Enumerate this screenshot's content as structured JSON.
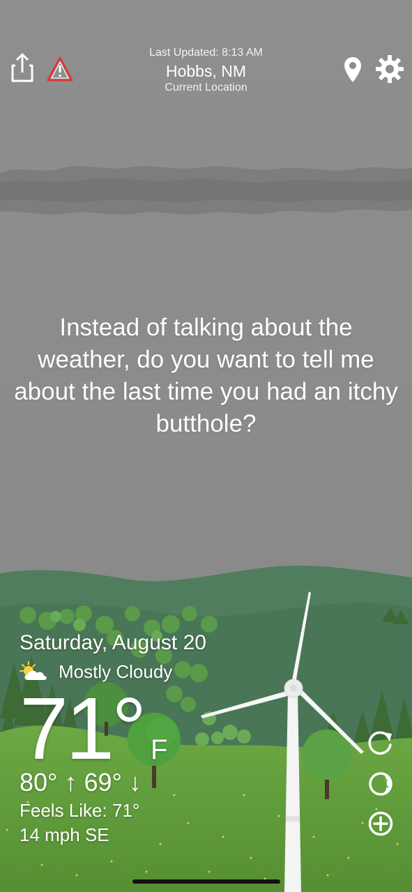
{
  "header": {
    "last_updated": "Last Updated: 8:13 AM",
    "city": "Hobbs, NM",
    "location_label": "Current Location"
  },
  "toolbar": {
    "share_icon": "share-icon",
    "alert_icon": "warning-icon",
    "location_icon": "map-pin-icon",
    "settings_icon": "gear-icon"
  },
  "message": "Instead of talking about the weather, do you want to tell me about the last time you had an itchy butthole?",
  "weather": {
    "date": "Saturday, August 20",
    "condition": "Mostly Cloudy",
    "condition_icon": "partly-cloudy-icon",
    "temperature": "71°",
    "unit": "F",
    "high_low": "80° ↑ 69° ↓",
    "feels_like": "Feels Like: 71°",
    "wind": "14 mph SE"
  },
  "side_actions": {
    "refresh_icon": "refresh-icon",
    "radar_icon": "moon-phase-icon",
    "add_icon": "add-circle-icon"
  },
  "colors": {
    "sky": "#8c8c8c",
    "hill_dark": "#4d7a5a",
    "grass": "#5f9a3c",
    "alert": "#d93a3a"
  }
}
